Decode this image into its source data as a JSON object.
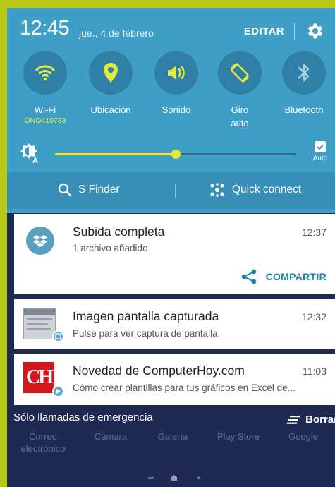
{
  "status": {
    "time": "12:45",
    "date": "jue., 4 de febrero",
    "edit_label": "EDITAR"
  },
  "toggles": [
    {
      "label": "Wi-Fi",
      "sublabel": "ONO410783",
      "icon": "wifi-icon"
    },
    {
      "label": "Ubicación",
      "icon": "location-icon"
    },
    {
      "label": "Sonido",
      "icon": "sound-icon"
    },
    {
      "label": "Giro auto",
      "label_line1": "Giro",
      "label_line2": "auto",
      "icon": "auto-rotate-icon"
    },
    {
      "label": "Bluetooth",
      "icon": "bluetooth-icon"
    }
  ],
  "brightness": {
    "level": 0.5,
    "auto_label": "Auto",
    "auto_checked": true
  },
  "actions": {
    "finder_label": "S Finder",
    "quick_connect_label": "Quick connect"
  },
  "notifications": [
    {
      "title": "Subida completa",
      "time": "12:37",
      "desc": "1 archivo añadido",
      "action_label": "COMPARTIR",
      "icon": "dropbox-icon"
    },
    {
      "title": "Imagen pantalla capturada",
      "time": "12:32",
      "desc": "Pulse para ver captura de pantalla",
      "icon": "screenshot-thumbnail"
    },
    {
      "title": "Novedad de ComputerHoy.com",
      "time": "11:03",
      "desc": "Cómo crear plantillas para tus gráficos en Excel de...",
      "icon": "computerhoy-logo",
      "logo_text": "CH"
    }
  ],
  "footer": {
    "emergency_text": "Sólo llamadas de emergencia",
    "clear_label": "Borrar"
  },
  "background_apps": {
    "app1_line1": "Correo",
    "app1_line2": "electrónico",
    "app2": "Cámara",
    "app3": "Galería",
    "app4": "Play Store",
    "app5": "Google"
  },
  "colors": {
    "panel": "#3f9ec6",
    "accent": "#e4ea3a",
    "link": "#1b7fb0",
    "frame": "#b7c81a"
  }
}
